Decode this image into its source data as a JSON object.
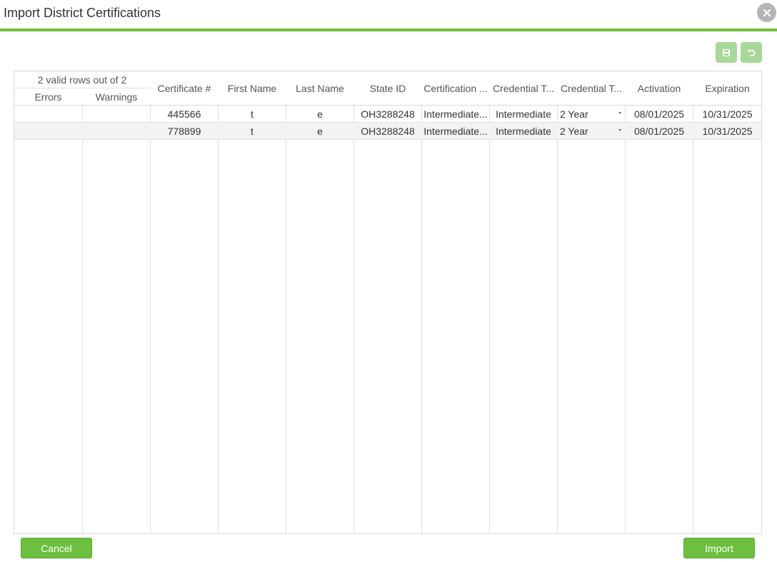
{
  "dialog": {
    "title": "Import District Certifications"
  },
  "toolbar": {
    "save_icon": "save-icon",
    "undo_icon": "undo-icon"
  },
  "grid": {
    "summary": "2 valid rows out of 2",
    "sub_headers": [
      "Errors",
      "Warnings"
    ],
    "headers": [
      "Certificate #",
      "First Name",
      "Last Name",
      "State ID",
      "Certification ...",
      "Credential T...",
      "Credential T...",
      "Activation",
      "Expiration"
    ],
    "rows": [
      {
        "errors": "",
        "warnings": "",
        "certificate": "445566",
        "first_name": "t",
        "last_name": "e",
        "state_id": "OH3288248",
        "certification": "Intermediate...",
        "credential_type": "Intermediate",
        "credential_term": "2 Year",
        "activation": "08/01/2025",
        "expiration": "10/31/2025"
      },
      {
        "errors": "",
        "warnings": "",
        "certificate": "778899",
        "first_name": "t",
        "last_name": "e",
        "state_id": "OH3288248",
        "certification": "Intermediate...",
        "credential_type": "Intermediate",
        "credential_term": "2 Year",
        "activation": "08/01/2025",
        "expiration": "10/31/2025"
      }
    ]
  },
  "footer": {
    "cancel_label": "Cancel",
    "import_label": "Import"
  },
  "colors": {
    "accent": "#6cbf3f",
    "accent_light": "#a8d899"
  }
}
